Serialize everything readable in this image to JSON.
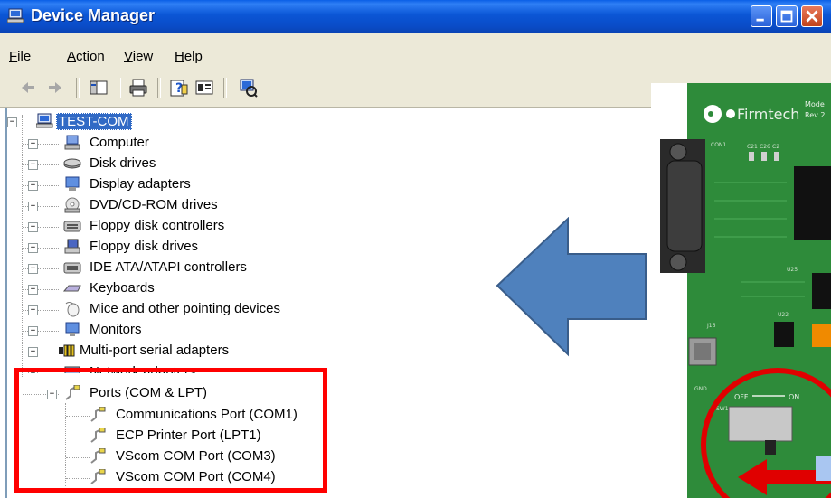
{
  "window": {
    "title": "Device Manager",
    "title_icon": "computer-icon",
    "buttons": [
      "minimize-icon",
      "maximize-icon",
      "close-icon"
    ]
  },
  "menu": [
    {
      "label": "File",
      "accel": "F",
      "rest": "ile"
    },
    {
      "label": "Action",
      "accel": "A",
      "rest": "ction"
    },
    {
      "label": "View",
      "accel": "V",
      "rest": "iew"
    },
    {
      "label": "Help",
      "accel": "H",
      "rest": "elp"
    }
  ],
  "toolbar": {
    "items": [
      "back-arrow-icon",
      "forward-arrow-icon",
      "show-hide-console-tree-icon",
      "print-icon",
      "help-icon",
      "properties-icon",
      "scan-hardware-icon"
    ]
  },
  "tree": {
    "root": {
      "label": "TEST-COM",
      "expander": "−",
      "icon": "computer-icon"
    },
    "categories": [
      {
        "label": "Computer",
        "icon": "computer-icon",
        "expander": "+"
      },
      {
        "label": "Disk drives",
        "icon": "disk-drive-icon",
        "expander": "+"
      },
      {
        "label": "Display adapters",
        "icon": "display-adapter-icon",
        "expander": "+"
      },
      {
        "label": "DVD/CD-ROM drives",
        "icon": "cdrom-icon",
        "expander": "+"
      },
      {
        "label": "Floppy disk controllers",
        "icon": "controller-icon",
        "expander": "+"
      },
      {
        "label": "Floppy disk drives",
        "icon": "floppy-drive-icon",
        "expander": "+"
      },
      {
        "label": "IDE ATA/ATAPI controllers",
        "icon": "controller-icon",
        "expander": "+"
      },
      {
        "label": "Keyboards",
        "icon": "keyboard-icon",
        "expander": "+"
      },
      {
        "label": "Mice and other pointing devices",
        "icon": "mouse-icon",
        "expander": "+"
      },
      {
        "label": "Monitors",
        "icon": "monitor-icon",
        "expander": "+"
      },
      {
        "label": "Multi-port serial adapters",
        "icon": "serial-adapter-icon",
        "expander": "+"
      },
      {
        "label": "Network adapters",
        "icon": "network-adapter-icon",
        "expander": "+"
      },
      {
        "label": "Ports (COM & LPT)",
        "icon": "port-icon",
        "expander": "−"
      }
    ],
    "ports": [
      {
        "label": "Communications Port (COM1)",
        "icon": "port-icon"
      },
      {
        "label": "ECP Printer Port (LPT1)",
        "icon": "port-icon"
      },
      {
        "label": "VScom COM Port (COM3)",
        "icon": "port-icon"
      },
      {
        "label": "VScom COM Port (COM4)",
        "icon": "port-icon"
      }
    ]
  },
  "overlay": {
    "arrow_color": "#4f81bd",
    "highlight_color": "#ff0000",
    "board": {
      "brand": "Firmtech",
      "model_line1": "Mode",
      "model_line2": "Rev 2",
      "switch_label_off": "OFF",
      "switch_label_on": "ON",
      "silk_labels": [
        "CON1",
        "C21",
        "C26",
        "C2",
        "U25",
        "U22",
        "J16",
        "SW1",
        "GND"
      ]
    }
  },
  "colors": {
    "titlebar": "#0a56d6",
    "chrome": "#ece9d8",
    "selection": "#316ac5",
    "pcb_green": "#2e8b3a"
  }
}
